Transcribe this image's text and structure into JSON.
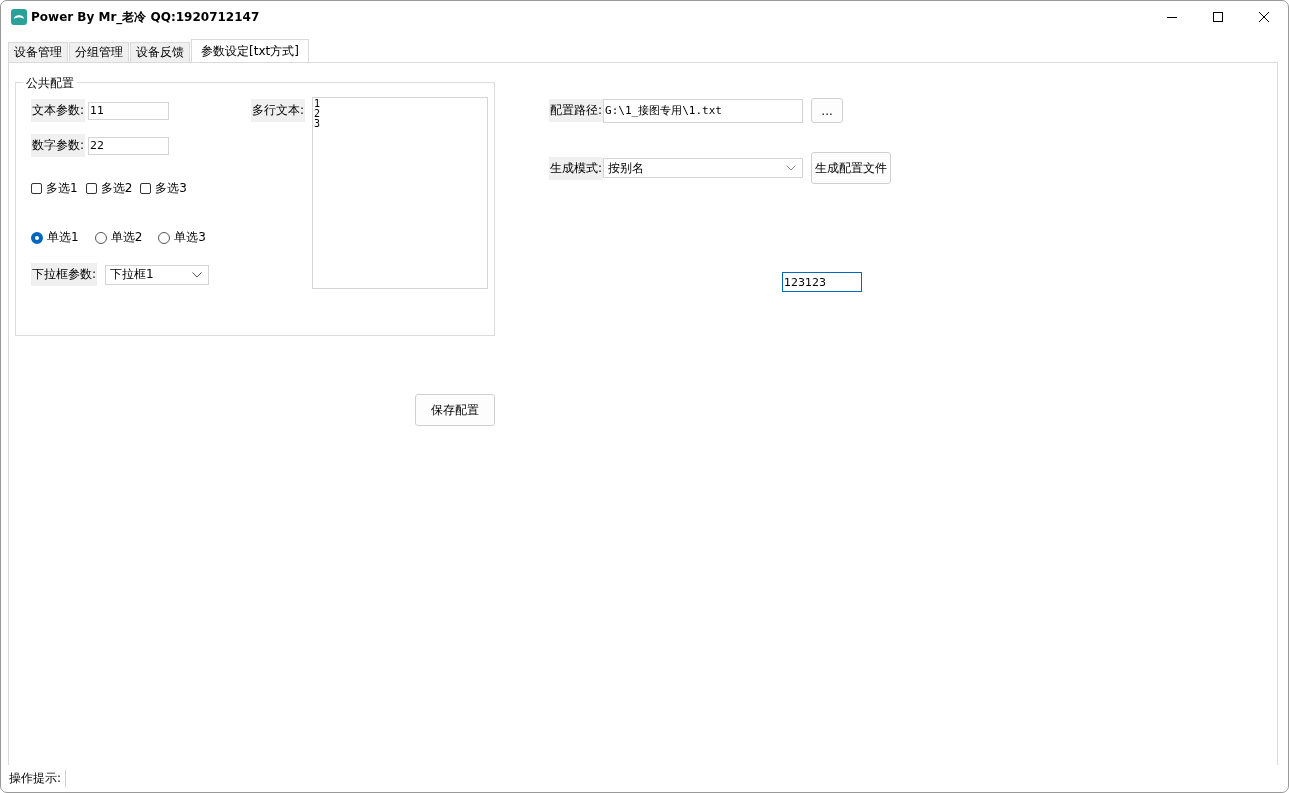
{
  "window": {
    "title": "Power By Mr_老冷 QQ:1920712147"
  },
  "tabs": [
    {
      "label": "设备管理",
      "selected": false
    },
    {
      "label": "分组管理",
      "selected": false
    },
    {
      "label": "设备反馈",
      "selected": false
    },
    {
      "label": "参数设定[txt方式]",
      "selected": true
    }
  ],
  "group": {
    "title": "公共配置",
    "text_param": {
      "label": "文本参数:",
      "value": "11"
    },
    "number_param": {
      "label": "数字参数:",
      "value": "22"
    },
    "checkboxes": [
      {
        "label": "多选1",
        "checked": false
      },
      {
        "label": "多选2",
        "checked": false
      },
      {
        "label": "多选3",
        "checked": false
      }
    ],
    "radios": [
      {
        "label": "单选1",
        "selected": true
      },
      {
        "label": "单选2",
        "selected": false
      },
      {
        "label": "单选3",
        "selected": false
      }
    ],
    "dropdown": {
      "label": "下拉框参数:",
      "value": "下拉框1"
    },
    "multiline": {
      "label": "多行文本:",
      "lines": [
        "1",
        "2",
        "3"
      ]
    }
  },
  "save_button": "保存配置",
  "config_path": {
    "label": "配置路径:",
    "value": "G:\\1_接图专用\\1.txt",
    "browse_button": "..."
  },
  "generate_mode": {
    "label": "生成模式:",
    "value": "按别名",
    "generate_button": "生成配置文件"
  },
  "extra_field": {
    "value": "123123",
    "focused": true
  },
  "status_bar": {
    "label": "操作提示:"
  }
}
